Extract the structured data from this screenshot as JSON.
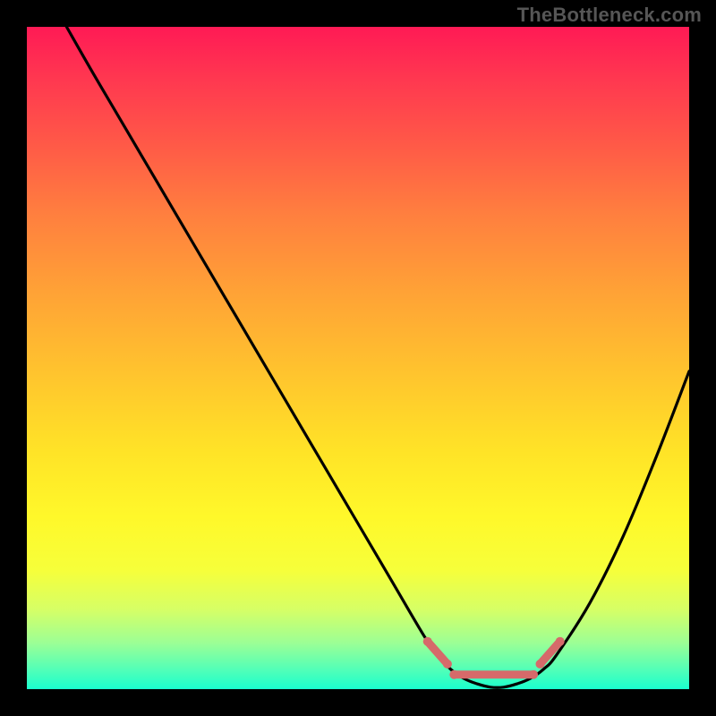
{
  "watermark": "TheBottleneck.com",
  "chart_data": {
    "type": "line",
    "title": "",
    "xlabel": "",
    "ylabel": "",
    "xlim": [
      0,
      100
    ],
    "ylim": [
      0,
      100
    ],
    "series": [
      {
        "name": "curve",
        "color": "#000000",
        "x": [
          6,
          10,
          15,
          20,
          25,
          30,
          35,
          40,
          45,
          50,
          55,
          60,
          62,
          64,
          66,
          68,
          70,
          72,
          74,
          76,
          78,
          80,
          85,
          90,
          95,
          100
        ],
        "y": [
          100,
          93,
          84.5,
          76,
          67.5,
          59,
          50.5,
          42,
          33.5,
          25,
          16.5,
          8,
          5.2,
          3.0,
          1.6,
          0.8,
          0.3,
          0.3,
          0.8,
          1.6,
          3.0,
          5.2,
          13,
          23,
          35,
          48
        ]
      }
    ],
    "highlight": {
      "name": "bottom-band",
      "color": "#d66a6a",
      "segments": [
        {
          "x": [
            60.5,
            63.5
          ],
          "y": [
            7.2,
            3.8
          ]
        },
        {
          "x": [
            64.5,
            76.5
          ],
          "y": [
            2.2,
            2.2
          ]
        },
        {
          "x": [
            77.5,
            80.5
          ],
          "y": [
            3.8,
            7.2
          ]
        }
      ]
    }
  }
}
